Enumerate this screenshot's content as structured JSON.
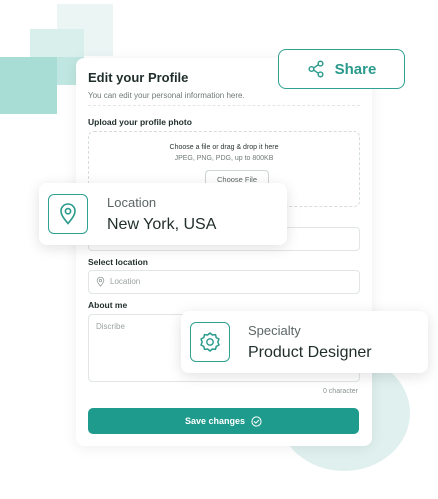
{
  "form": {
    "title": "Edit your Profile",
    "subtitle": "You can edit your personal information here.",
    "upload_label": "Upload your profile photo",
    "upload_hint": "Choose a file or drag & drop it here",
    "upload_formats": "JPEG, PNG, PDG, up to 800KB",
    "choose_file": "Choose File",
    "select_location_label": "Select location",
    "location_placeholder": "Location",
    "about_label": "About me",
    "about_placeholder": "Discribe",
    "char_count": "0 character",
    "save_label": "Save changes"
  },
  "share": {
    "label": "Share"
  },
  "location_card": {
    "label": "Location",
    "value": "New York, USA"
  },
  "specialty_card": {
    "label": "Specialty",
    "value": "Product Designer"
  },
  "colors": {
    "accent": "#1f9b8d",
    "accent_light": "#dff0ee"
  }
}
